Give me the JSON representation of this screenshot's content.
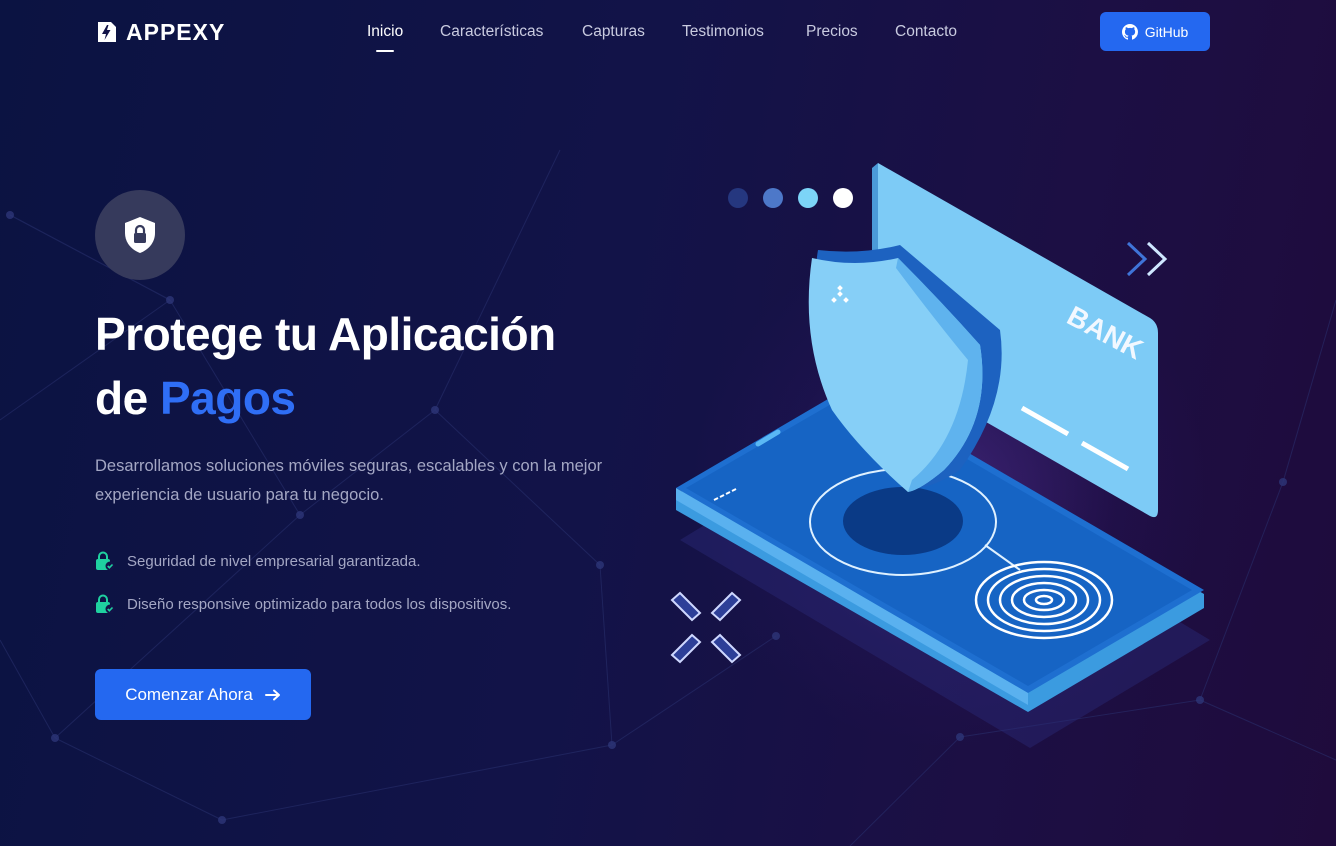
{
  "brand": {
    "name": "APPEXY",
    "icon": "bolt-document-icon"
  },
  "nav": {
    "items": [
      {
        "label": "Inicio",
        "active": true
      },
      {
        "label": "Características",
        "active": false
      },
      {
        "label": "Capturas",
        "active": false
      },
      {
        "label": "Testimonios",
        "active": false
      },
      {
        "label": "Precios",
        "active": false
      },
      {
        "label": "Contacto",
        "active": false
      }
    ],
    "github_label": "GitHub",
    "github_icon": "github-icon"
  },
  "hero": {
    "badge_icon": "shield-lock-icon",
    "title_line1": "Protege tu Aplicación",
    "title_line2_prefix": "de ",
    "title_accent": "Pagos",
    "description": "Desarrollamos soluciones móviles seguras, escalables y con la mejor experiencia de usuario para tu negocio.",
    "features": [
      {
        "icon": "lock-check-icon",
        "text": "Seguridad de nivel empresarial garantizada."
      },
      {
        "icon": "lock-check-icon",
        "text": "Diseño responsive optimizado para todos los dispositivos."
      }
    ],
    "cta_label": "Comenzar Ahora",
    "cta_icon": "arrow-right-icon"
  },
  "illustration": {
    "card_text": "BANK",
    "icons": [
      "shield-icon",
      "fingerprint-icon",
      "credit-card-icon",
      "smartphone-icon",
      "chevrons-right-icon"
    ]
  },
  "colors": {
    "accent": "#2468f0",
    "accent_text": "#2f6ef5",
    "feature_icon": "#1fd1a0",
    "background": "#121348"
  }
}
